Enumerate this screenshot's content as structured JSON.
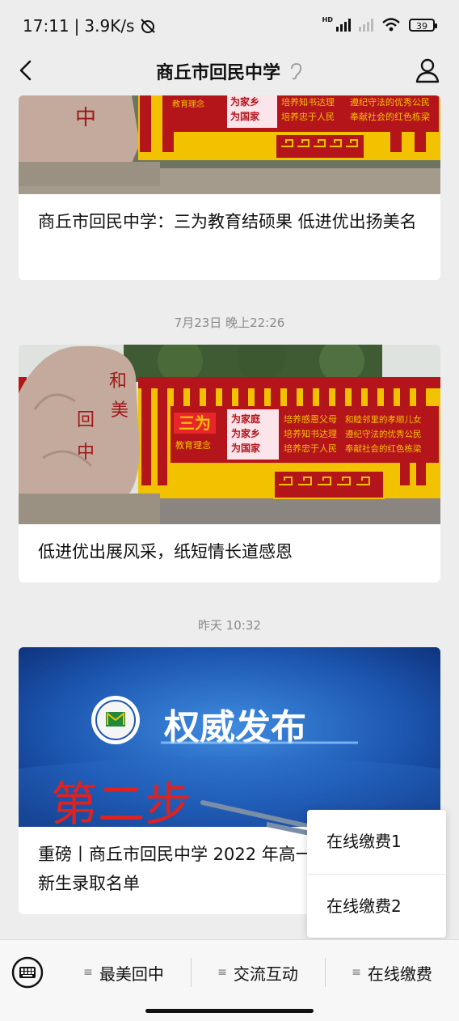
{
  "status_bar": {
    "time": "17:11",
    "separator": "|",
    "speed": "3.9K/s",
    "hd_label": "HD",
    "battery": "39"
  },
  "nav": {
    "title": "商丘市回民中学"
  },
  "articles": [
    {
      "caption": "商丘市回民中学：三为教育结硕果  低进优出扬美名"
    },
    {
      "timestamp": "7月23日 晚上22:26",
      "caption": "低进优出展风采，纸短情长道感恩"
    },
    {
      "timestamp": "昨天 10:32",
      "banner_text": "权威发布",
      "annotation": "第二步",
      "caption": "重磅丨商丘市回民中学 2022 年高一新生录取名单"
    }
  ],
  "image_text": {
    "sanwei": "三为",
    "jiaoyu_linian": "教育理念",
    "weijia": [
      "为家庭",
      "为家乡",
      "为国家"
    ],
    "col1": [
      "培养感恩父母",
      "培养知书达理",
      "培养忠于人民"
    ],
    "col2": [
      "和睦邻里的孝顺儿女",
      "遵纪守法的优秀公民",
      "奉献社会的红色栋梁"
    ],
    "stone": [
      "和",
      "美",
      "回",
      "中"
    ]
  },
  "popup_menu": {
    "items": [
      "在线缴费1",
      "在线缴费2"
    ]
  },
  "bottom_menu": {
    "items": [
      "最美回中",
      "交流互动",
      "在线缴费"
    ]
  },
  "colors": {
    "accent_red": "#b4151b",
    "banner_blue": "#1c56b0",
    "annotation_red": "#e0221f",
    "wall_yellow": "#f2c100"
  }
}
